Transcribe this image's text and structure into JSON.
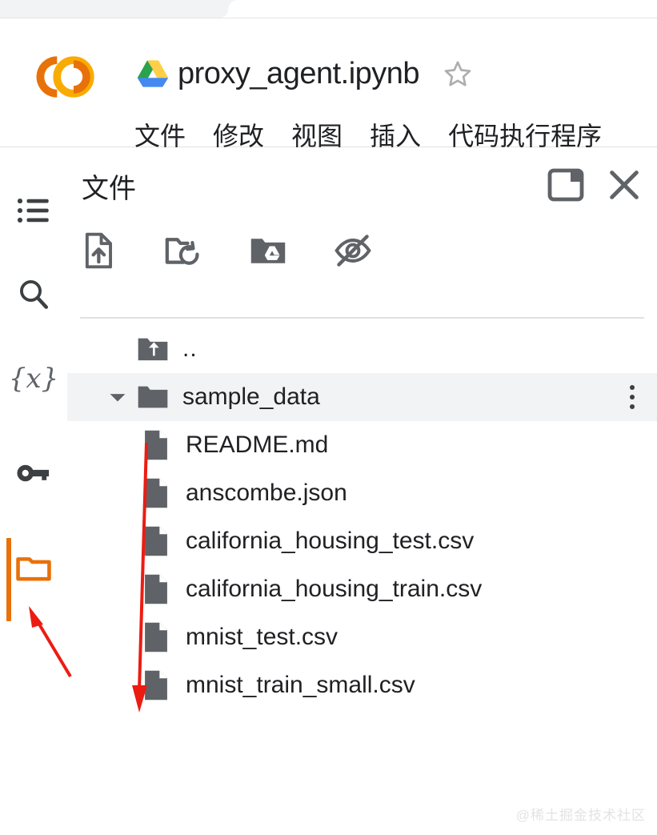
{
  "browser": {
    "tab_strip_label": "browser-tab-strip"
  },
  "header": {
    "logo_name": "colab-logo",
    "drive_icon_name": "google-drive-icon",
    "document_title": "proxy_agent.ipynb",
    "star_label": "star-icon",
    "menu_items": [
      {
        "label": "文件"
      },
      {
        "label": "修改"
      },
      {
        "label": "视图"
      },
      {
        "label": "插入"
      },
      {
        "label": "代码执行程序"
      }
    ]
  },
  "activity_bar": {
    "items": [
      {
        "name": "table-of-contents",
        "icon": "list-icon",
        "active": false
      },
      {
        "name": "search",
        "icon": "search-icon",
        "active": false
      },
      {
        "name": "variables",
        "icon": "variables-icon",
        "glyph": "{x}",
        "active": false
      },
      {
        "name": "secrets",
        "icon": "key-icon",
        "active": false
      },
      {
        "name": "files",
        "icon": "folder-icon",
        "active": true
      }
    ],
    "active_color": "#e8710a"
  },
  "files_panel": {
    "title": "文件",
    "actions": [
      {
        "name": "dock-panel-button",
        "icon": "panel-dock-icon"
      },
      {
        "name": "close-panel-button",
        "icon": "close-icon"
      }
    ],
    "toolbar": [
      {
        "name": "upload-file-button",
        "icon": "upload-file-icon"
      },
      {
        "name": "refresh-folder-button",
        "icon": "refresh-folder-icon"
      },
      {
        "name": "mount-drive-button",
        "icon": "mount-drive-icon"
      },
      {
        "name": "toggle-hidden-button",
        "icon": "eye-off-icon"
      }
    ],
    "tree": [
      {
        "label": "..",
        "type": "parent",
        "indent": 1,
        "selected": false,
        "expandable": false,
        "has_menu": false
      },
      {
        "label": "sample_data",
        "type": "folder",
        "indent": 1,
        "selected": true,
        "expandable": true,
        "expanded": true,
        "has_menu": true
      },
      {
        "label": "README.md",
        "type": "file",
        "indent": 2,
        "selected": false,
        "expandable": false,
        "has_menu": false
      },
      {
        "label": "anscombe.json",
        "type": "file",
        "indent": 2,
        "selected": false,
        "expandable": false,
        "has_menu": false
      },
      {
        "label": "california_housing_test.csv",
        "type": "file",
        "indent": 2,
        "selected": false,
        "expandable": false,
        "has_menu": false
      },
      {
        "label": "california_housing_train.csv",
        "type": "file",
        "indent": 2,
        "selected": false,
        "expandable": false,
        "has_menu": false
      },
      {
        "label": "mnist_test.csv",
        "type": "file",
        "indent": 2,
        "selected": false,
        "expandable": false,
        "has_menu": false
      },
      {
        "label": "mnist_train_small.csv",
        "type": "file",
        "indent": 2,
        "selected": false,
        "expandable": false,
        "has_menu": false
      }
    ]
  },
  "annotations": {
    "color": "#ec1c12",
    "arrows": [
      {
        "name": "arrow-to-files-icon",
        "direction": "up-left"
      },
      {
        "name": "arrow-down-file-list",
        "direction": "down"
      }
    ]
  },
  "watermark": {
    "text": "@稀土掘金技术社区"
  }
}
